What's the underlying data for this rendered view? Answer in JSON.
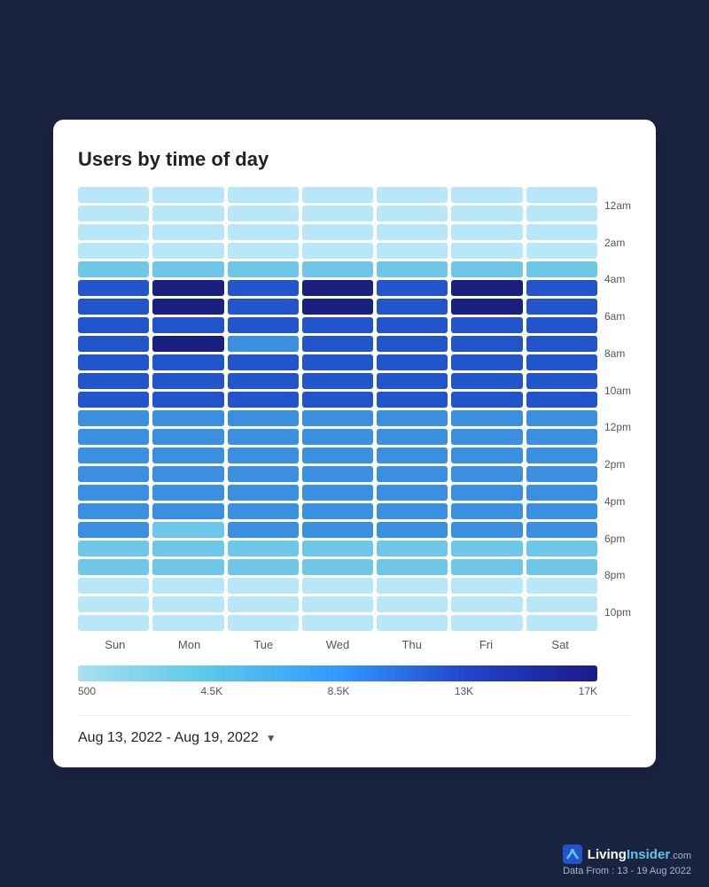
{
  "title": "Users by time of day",
  "yLabels": [
    "12am",
    "2am",
    "4am",
    "6am",
    "8am",
    "10am",
    "12pm",
    "2pm",
    "4pm",
    "6pm",
    "8pm",
    "10pm"
  ],
  "xLabels": [
    "Sun",
    "Mon",
    "Tue",
    "Wed",
    "Thu",
    "Fri",
    "Sat"
  ],
  "legendLabels": [
    "500",
    "4.5K",
    "8.5K",
    "13K",
    "17K"
  ],
  "dateRange": "Aug 13, 2022 - Aug 19, 2022",
  "footer": {
    "logo": "LivingInsider",
    "logoSuffix": ".com",
    "dataFrom": "Data From : 13 - 19  Aug 2022"
  },
  "heatmap": {
    "rows": [
      [
        1,
        1,
        1,
        1,
        1,
        1,
        1
      ],
      [
        1,
        1,
        1,
        1,
        1,
        1,
        1
      ],
      [
        1,
        1,
        1,
        1,
        1,
        1,
        1
      ],
      [
        1,
        1,
        1,
        1,
        1,
        1,
        1
      ],
      [
        2,
        2,
        2,
        2,
        2,
        2,
        2
      ],
      [
        4,
        5,
        4,
        5,
        4,
        5,
        4
      ],
      [
        4,
        5,
        4,
        5,
        4,
        5,
        4
      ],
      [
        4,
        4,
        4,
        4,
        4,
        4,
        4
      ],
      [
        4,
        5,
        3,
        4,
        4,
        4,
        4
      ],
      [
        4,
        4,
        4,
        4,
        4,
        4,
        4
      ],
      [
        4,
        4,
        4,
        4,
        4,
        4,
        4
      ],
      [
        4,
        4,
        4,
        4,
        4,
        4,
        4
      ],
      [
        3,
        3,
        3,
        3,
        3,
        3,
        3
      ],
      [
        3,
        3,
        3,
        3,
        3,
        3,
        3
      ],
      [
        3,
        3,
        3,
        3,
        3,
        3,
        3
      ],
      [
        3,
        3,
        3,
        3,
        3,
        3,
        3
      ],
      [
        3,
        3,
        3,
        3,
        3,
        3,
        3
      ],
      [
        3,
        3,
        3,
        3,
        3,
        3,
        3
      ],
      [
        3,
        2,
        3,
        3,
        3,
        3,
        3
      ],
      [
        2,
        2,
        2,
        2,
        2,
        2,
        2
      ],
      [
        2,
        2,
        2,
        2,
        2,
        2,
        2
      ],
      [
        1,
        1,
        1,
        1,
        1,
        1,
        1
      ],
      [
        1,
        1,
        1,
        1,
        1,
        1,
        1
      ],
      [
        1,
        1,
        1,
        1,
        1,
        1,
        1
      ]
    ]
  },
  "colors": {
    "1": "#b8e8f7",
    "2": "#6ec6e8",
    "3": "#3a8fe0",
    "4": "#2255cc",
    "5": "#1a2080"
  }
}
